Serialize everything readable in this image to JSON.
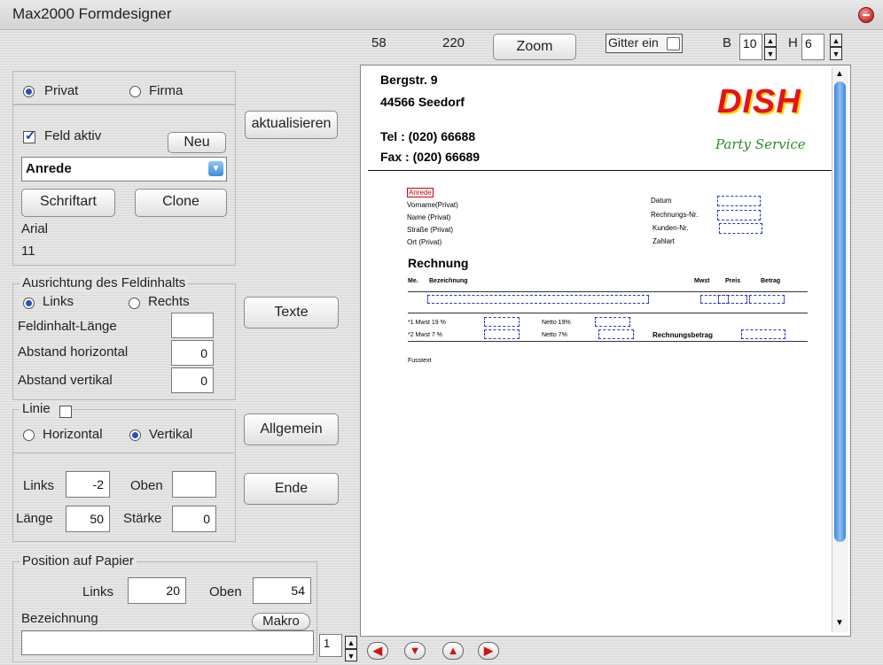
{
  "window": {
    "title": "Max2000 Formdesigner"
  },
  "toolbar": {
    "x_value": "58",
    "y_value": "220",
    "zoom_label": "Zoom",
    "grid_label": "Gitter ein",
    "b_label": "B",
    "b_value": "10",
    "h_label": "H",
    "h_value": "6"
  },
  "left": {
    "type_group": {
      "privat": "Privat",
      "firma": "Firma",
      "selected": "Privat"
    },
    "field": {
      "active_label": "Feld aktiv",
      "active_checked": true,
      "new_button": "Neu",
      "selected_field": "Anrede",
      "font_button": "Schriftart",
      "clone_button": "Clone",
      "font_name": "Arial",
      "font_size": "11"
    },
    "update_button": "aktualisieren",
    "alignment": {
      "legend": "Ausrichtung des Feldinhalts",
      "links": "Links",
      "rechts": "Rechts",
      "selected": "Links",
      "length_label": "Feldinhalt-Länge",
      "length_value": "",
      "h_dist_label": "Abstand horizontal",
      "h_dist_value": "0",
      "v_dist_label": "Abstand vertikal",
      "v_dist_value": "0"
    },
    "texte_button": "Texte",
    "line": {
      "legend": "Linie",
      "horizontal": "Horizontal",
      "vertikal": "Vertikal",
      "selected": "Vertikal",
      "links_label": "Links",
      "links_value": "-2",
      "oben_label": "Oben",
      "oben_value": "",
      "laenge_label": "Länge",
      "laenge_value": "50",
      "staerke_label": "Stärke",
      "staerke_value": "0"
    },
    "allgemein_button": "Allgemein",
    "ende_button": "Ende",
    "position": {
      "legend": "Position auf Papier",
      "links_label": "Links",
      "links_value": "20",
      "oben_label": "Oben",
      "oben_value": "54",
      "bez_label": "Bezeichnung",
      "makro_button": "Makro",
      "bez_value": ""
    },
    "page_number": "1"
  },
  "paper": {
    "address_line1": "Bergstr. 9",
    "address_line2": "44566 Seedorf",
    "tel": "Tel : (020) 66688",
    "fax": "Fax : (020) 66689",
    "logo_text": "DISH",
    "logo_sub": "Party Service",
    "fields_left": [
      "Anrede",
      "Vorname(Privat)",
      "Name (Privat)",
      "Straße (Privat)",
      "Ort (Privat)"
    ],
    "fields_right": [
      "Datum",
      "Rechnungs-Nr.",
      "Kunden-Nr.",
      "Zahlart"
    ],
    "heading": "Rechnung",
    "col_me": "Me.",
    "col_bez": "Bezeichnung",
    "col_mwst": "Mwst",
    "col_preis": "Preis",
    "col_betrag": "Betrag",
    "mwst1": "*1 Mwst 19 %",
    "mwst2": "*2 Mwst 7 %",
    "netto1": "Netto 19%",
    "netto2": "Netto 7%",
    "rechnungsbetrag": "Rechnungsbetrag",
    "fusstext": "Fusstext"
  }
}
